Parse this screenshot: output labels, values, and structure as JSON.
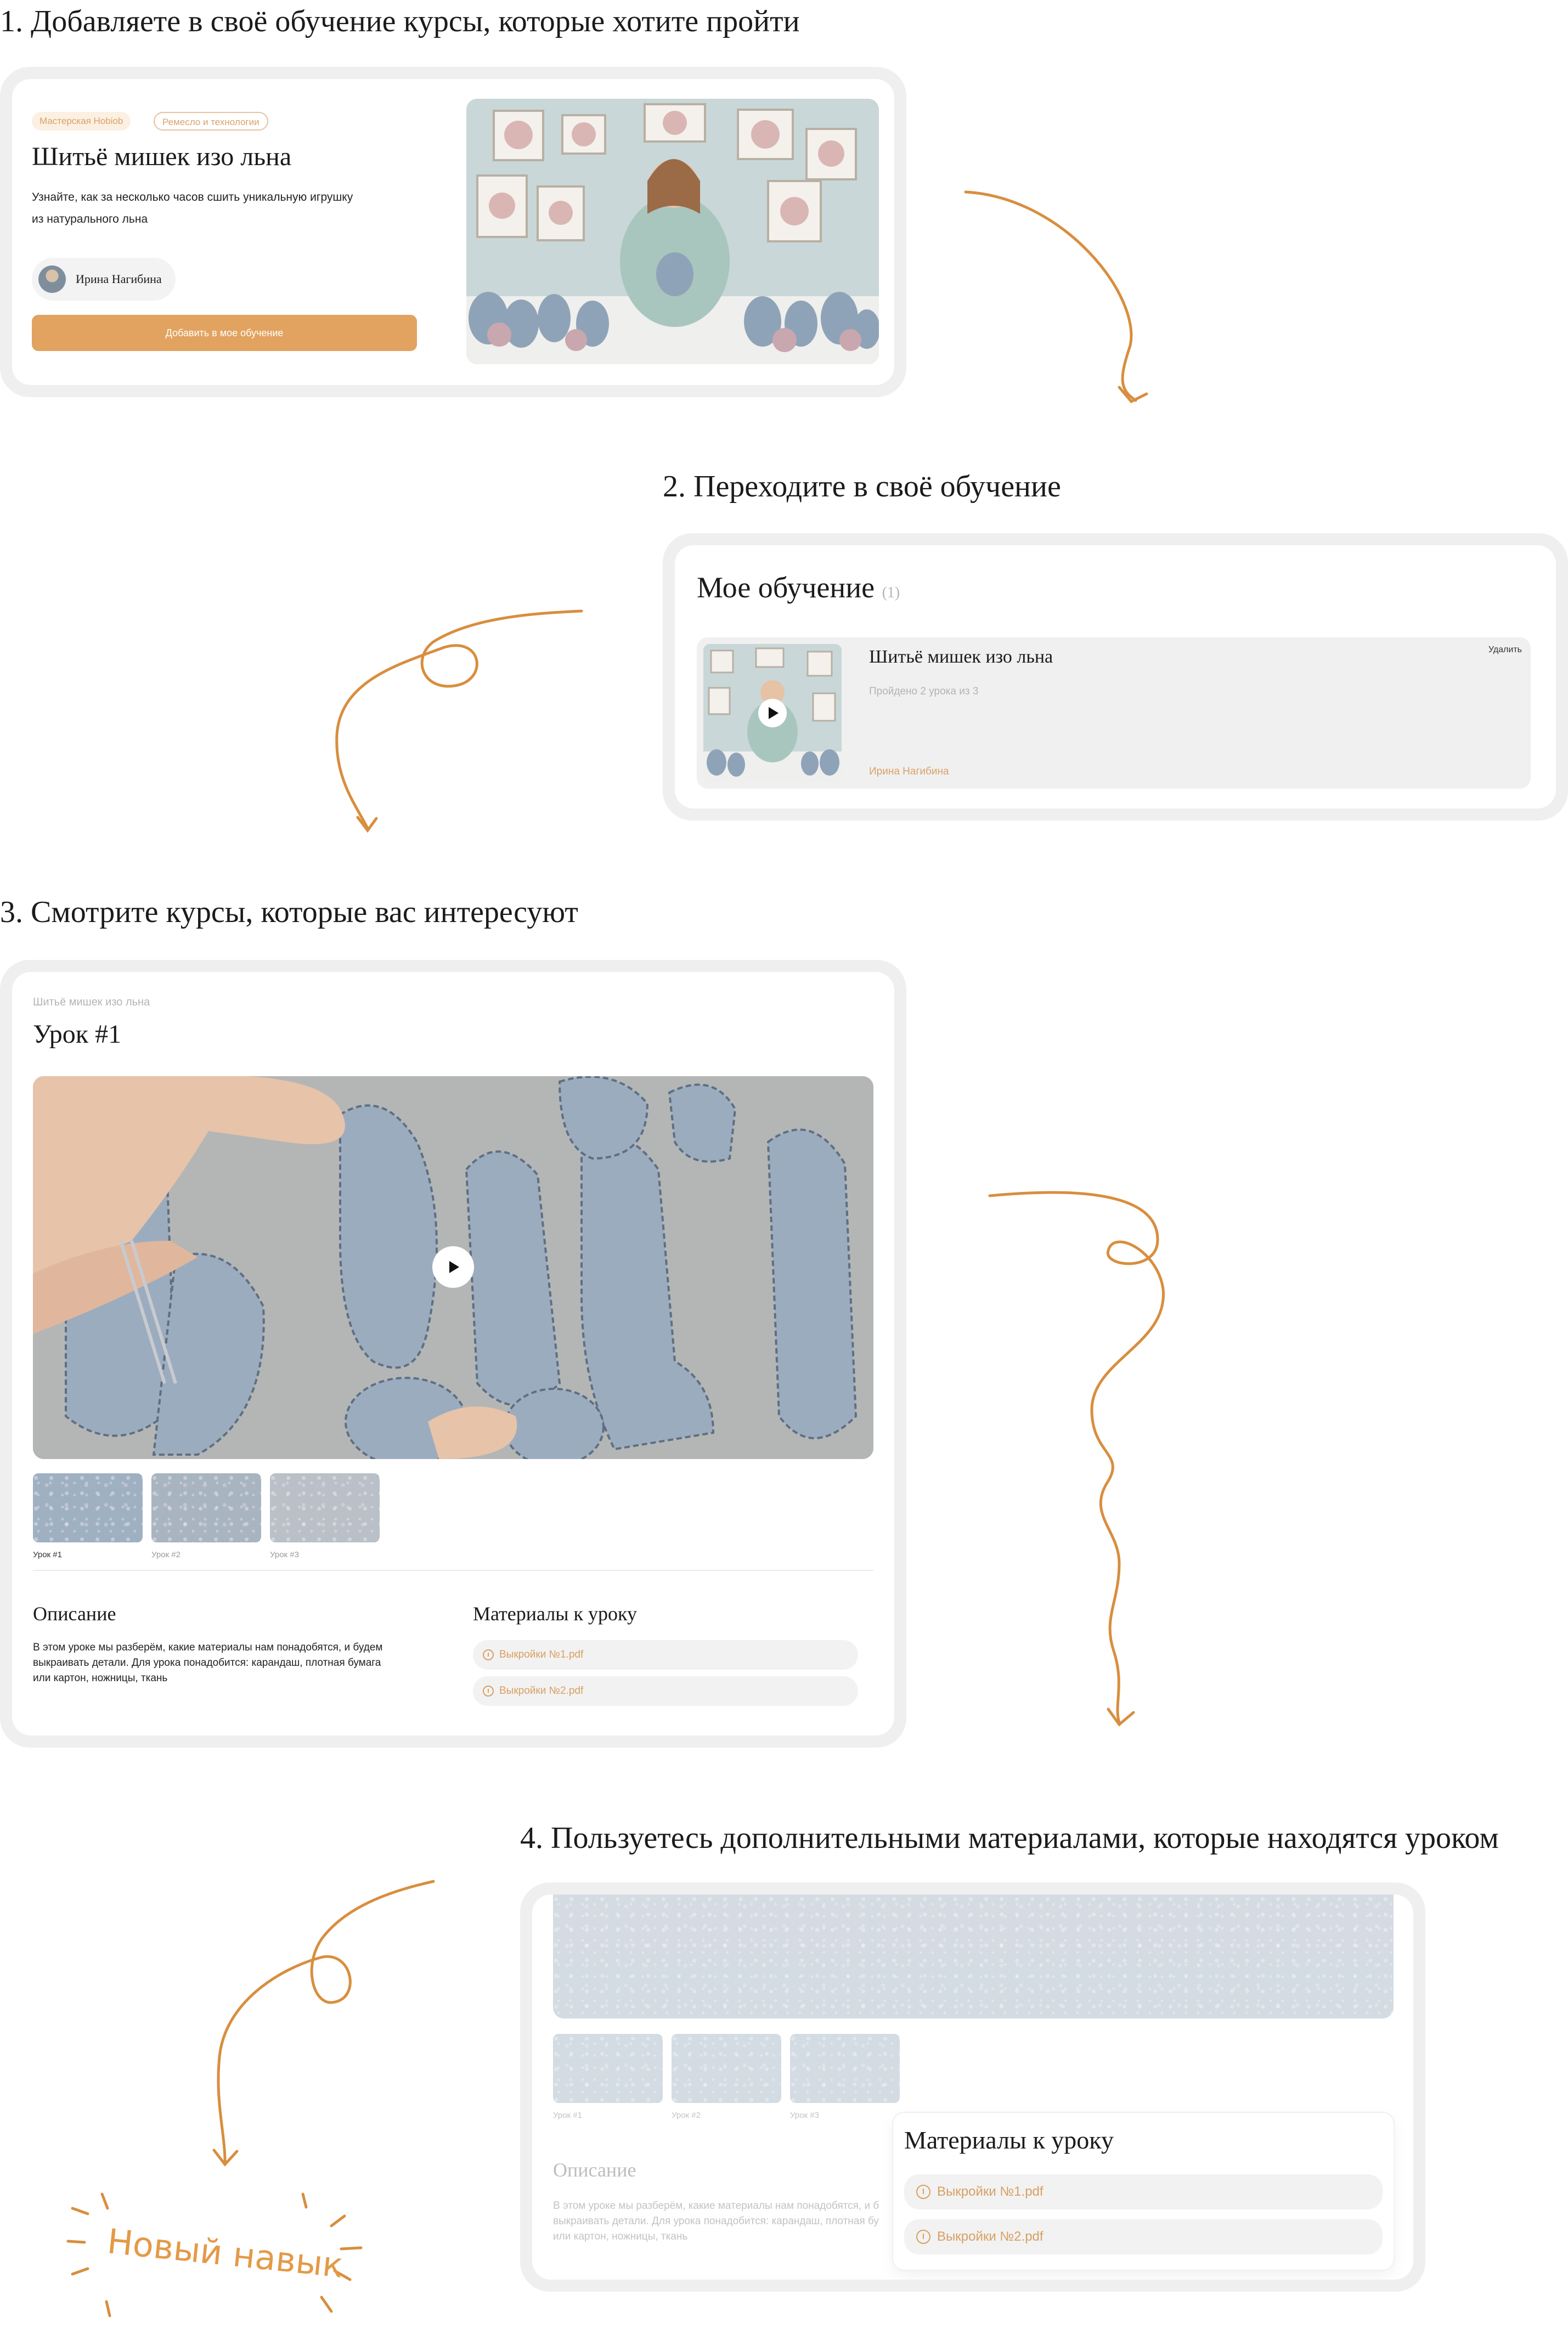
{
  "steps": {
    "s1": "1. Добавляете в своё обучение курсы, которые хотите пройти",
    "s2": "2. Переходите в своё обучение",
    "s3": "3. Смотрите курсы, которые вас интересуют",
    "s4": "4. Пользуетесь дополнительными материалами, которые находятся уроком"
  },
  "course_card": {
    "tag_school": "Мастерская Hobiob",
    "tag_category": "Ремесло и технологии",
    "title": "Шитьё мишек изо льна",
    "description_line1": "Узнайте, как за несколько часов сшить уникальную игрушку",
    "description_line2": "из натурального льна",
    "author": "Ирина Нагибина",
    "add_button": "Добавить в мое обучение"
  },
  "my_learning": {
    "title": "Мое обучение",
    "count": "(1)",
    "item_title": "Шитьё мишек изо льна",
    "progress": "Пройдено 2 урока из 3",
    "author": "Ирина Нагибина",
    "remove": "Удалить"
  },
  "lesson": {
    "breadcrumb": "Шитьё мишек изо льна",
    "title": "Урок #1",
    "thumbs": [
      "Урок #1",
      "Урок #2",
      "Урок #3"
    ],
    "description_title": "Описание",
    "description_line1": "В этом уроке мы разберём, какие материалы нам понадобятся, и будем",
    "description_line2": "выкраивать детали. Для урока понадобится: карандаш, плотная бумага",
    "description_line3": "или картон, ножницы, ткань",
    "materials_title": "Материалы к уроку",
    "files": [
      "Выкройки №1.pdf",
      "Выкройки №2.pdf"
    ]
  },
  "materials_view": {
    "thumbs": [
      "Урок #1",
      "Урок #2",
      "Урок #3"
    ],
    "description_title": "Описание",
    "description_line1": "В этом уроке мы разберём, какие материалы нам понадобятся, и б",
    "description_line2": "выкраивать детали. Для урока понадобится: карандаш, плотная бу",
    "description_line3": "или картон, ножницы, ткань",
    "materials_title": "Материалы к уроку",
    "files": [
      "Выкройки №1.pdf",
      "Выкройки №2.pdf"
    ]
  },
  "badge": {
    "text": "Новый навык"
  },
  "colors": {
    "accent": "#e2a360",
    "stroke": "#d88e3e",
    "frame": "#efefef"
  }
}
